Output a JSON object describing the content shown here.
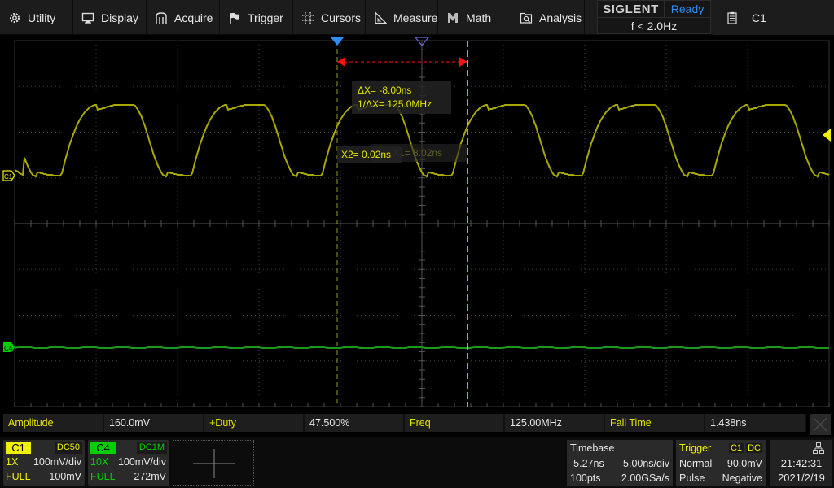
{
  "menu": {
    "items": [
      {
        "id": "utility",
        "label": "Utility",
        "icon": "gear-icon"
      },
      {
        "id": "display",
        "label": "Display",
        "icon": "monitor-icon"
      },
      {
        "id": "acquire",
        "label": "Acquire",
        "icon": "acquire-icon"
      },
      {
        "id": "trigger",
        "label": "Trigger",
        "icon": "flag-icon"
      },
      {
        "id": "cursors",
        "label": "Cursors",
        "icon": "grid-hash-icon"
      },
      {
        "id": "measure",
        "label": "Measure",
        "icon": "ruler-triangle-icon"
      },
      {
        "id": "math",
        "label": "Math",
        "icon": "math-m-icon"
      },
      {
        "id": "analysis",
        "label": "Analysis",
        "icon": "magnifier-doc-icon"
      }
    ]
  },
  "status": {
    "brand": "SIGLENT",
    "state": "Ready",
    "trigger_freq": "f < 2.0Hz",
    "active_channel": "C1"
  },
  "cursors": {
    "delta_x": "ΔX= -8.00ns",
    "inv_delta_x": "1/ΔX= 125.0MHz",
    "x2": "X2= 0.02ns",
    "x1": "X1= 8.02ns"
  },
  "measurements": [
    {
      "name": "Amplitude",
      "value": "160.0mV"
    },
    {
      "name": "+Duty",
      "value": "47.500%"
    },
    {
      "name": "Freq",
      "value": "125.00MHz"
    },
    {
      "name": "Fall Time",
      "value": "1.438ns"
    }
  ],
  "channels": [
    {
      "id": "C1",
      "coupling": "DC50",
      "probe": "1X",
      "scale": "100mV/div",
      "bandwidth": "FULL",
      "offset": "100mV",
      "color": "#f0f000"
    },
    {
      "id": "C4",
      "coupling": "DC1M",
      "probe": "10X",
      "scale": "100mV/div",
      "bandwidth": "FULL",
      "offset": "-272mV",
      "color": "#00d000"
    }
  ],
  "timebase": {
    "title": "Timebase",
    "delay": "-5.27ns",
    "scale": "5.00ns/div",
    "points": "100pts",
    "sample_rate": "2.00GSa/s"
  },
  "trigger": {
    "title": "Trigger",
    "source": "C1",
    "coupling": "DC",
    "mode": "Normal",
    "level": "90.0mV",
    "type": "Pulse",
    "polarity": "Negative"
  },
  "clock": {
    "time": "21:42:31",
    "date": "2021/2/19",
    "icon": "network-icon"
  },
  "markers": {
    "c1_label": "C1",
    "c4_label": "C4"
  },
  "colors": {
    "ch1": "#f0f000",
    "ch1_trace": "#a8a800",
    "ch4": "#00d000",
    "ch4_trace": "#1a9a1a",
    "cursor_arrow": "#ff1010",
    "trigger_pos_marker": "#2f8cf0",
    "status_ready": "#2f8cf0"
  },
  "waveforms": {
    "c1": {
      "period_ns": 8.0,
      "duty_percent": 47.5,
      "amplitude_mV": 160.0,
      "volts_per_div_mV": 100
    },
    "c4": {
      "description": "flat line near offset"
    }
  }
}
